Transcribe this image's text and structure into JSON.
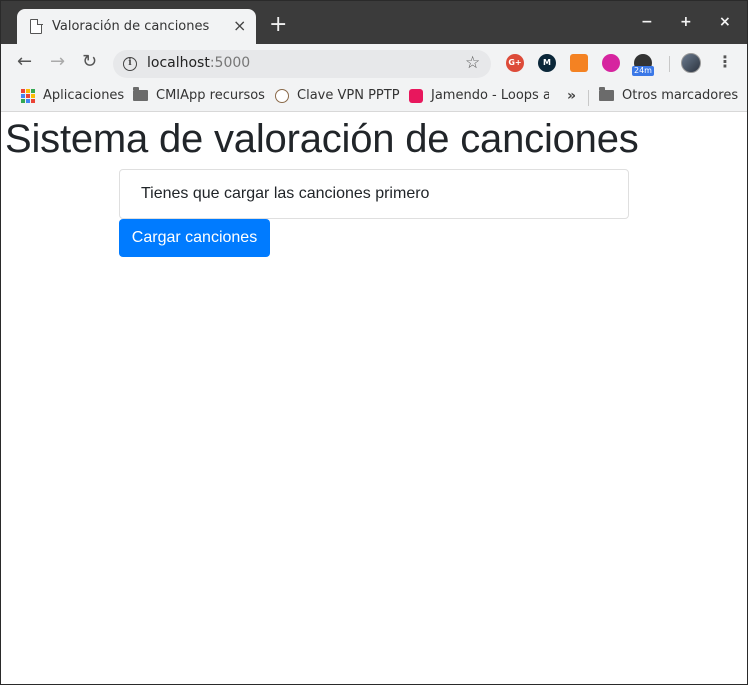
{
  "browser": {
    "tab_title": "Valoración de canciones",
    "new_tab_label": "+",
    "window_controls": {
      "minimize": "−",
      "maximize": "+",
      "close": "×"
    },
    "tab_close": "×"
  },
  "toolbar": {
    "back": "←",
    "forward": "→",
    "reload": "↻",
    "url_host": "localhost",
    "url_port": ":5000",
    "star": "☆",
    "extensions": [
      {
        "name": "google-plus-icon",
        "label": "G+",
        "color": "#dd4b39"
      },
      {
        "name": "movistar-icon",
        "label": "M",
        "color": "#0b2739"
      },
      {
        "name": "rss-icon",
        "label": "",
        "color": "#f48222"
      },
      {
        "name": "instagram-icon",
        "label": "",
        "color": "#d6249f"
      },
      {
        "name": "timer-icon",
        "label": "",
        "color": "#333333"
      }
    ],
    "timer_badge": "24m",
    "menu": "⋮"
  },
  "bookmarks": {
    "items": [
      {
        "label": "Aplicaciones"
      },
      {
        "label": "CMIApp recursos"
      },
      {
        "label": "Clave VPN PPTP"
      },
      {
        "label": "Jamendo - Loops a"
      }
    ],
    "more": "»",
    "other": "Otros marcadores"
  },
  "page": {
    "title": "Sistema de valoración de canciones",
    "notice": "Tienes que cargar las canciones primero",
    "load_button": "Cargar canciones",
    "accent_color": "#007bff"
  }
}
